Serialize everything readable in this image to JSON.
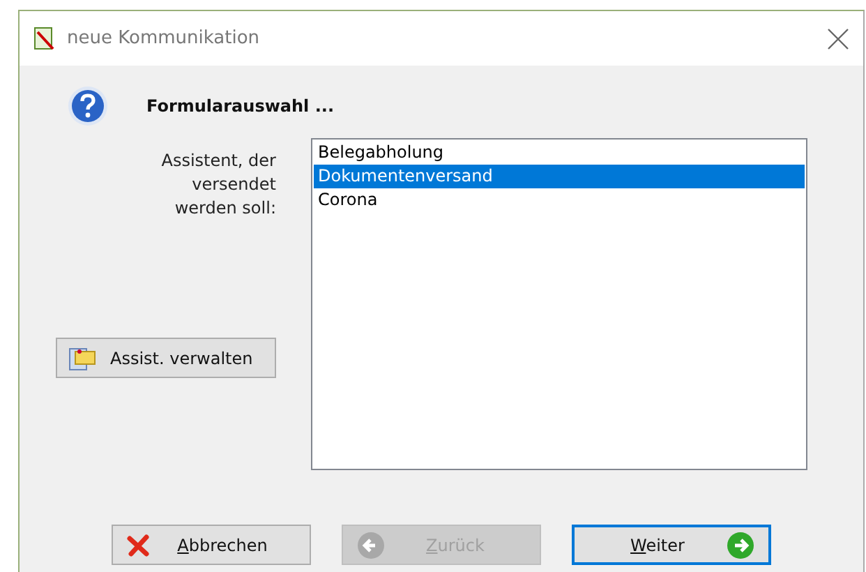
{
  "window": {
    "title": "neue Kommunikation"
  },
  "heading": "Formularauswahl ...",
  "prompt": "Assistent, der versendet werden soll:",
  "list": [
    {
      "label": "Belegabholung",
      "selected": false
    },
    {
      "label": "Dokumentenversand",
      "selected": true
    },
    {
      "label": "Corona",
      "selected": false
    }
  ],
  "manage_button": "Assist. verwalten",
  "buttons": [
    {
      "kind": "cancel",
      "label": "Abbrechen",
      "disabled": false,
      "default": false
    },
    {
      "kind": "back",
      "label": "Zurück",
      "disabled": true,
      "default": false
    },
    {
      "kind": "next",
      "label": "Weiter",
      "disabled": false,
      "default": true
    }
  ]
}
